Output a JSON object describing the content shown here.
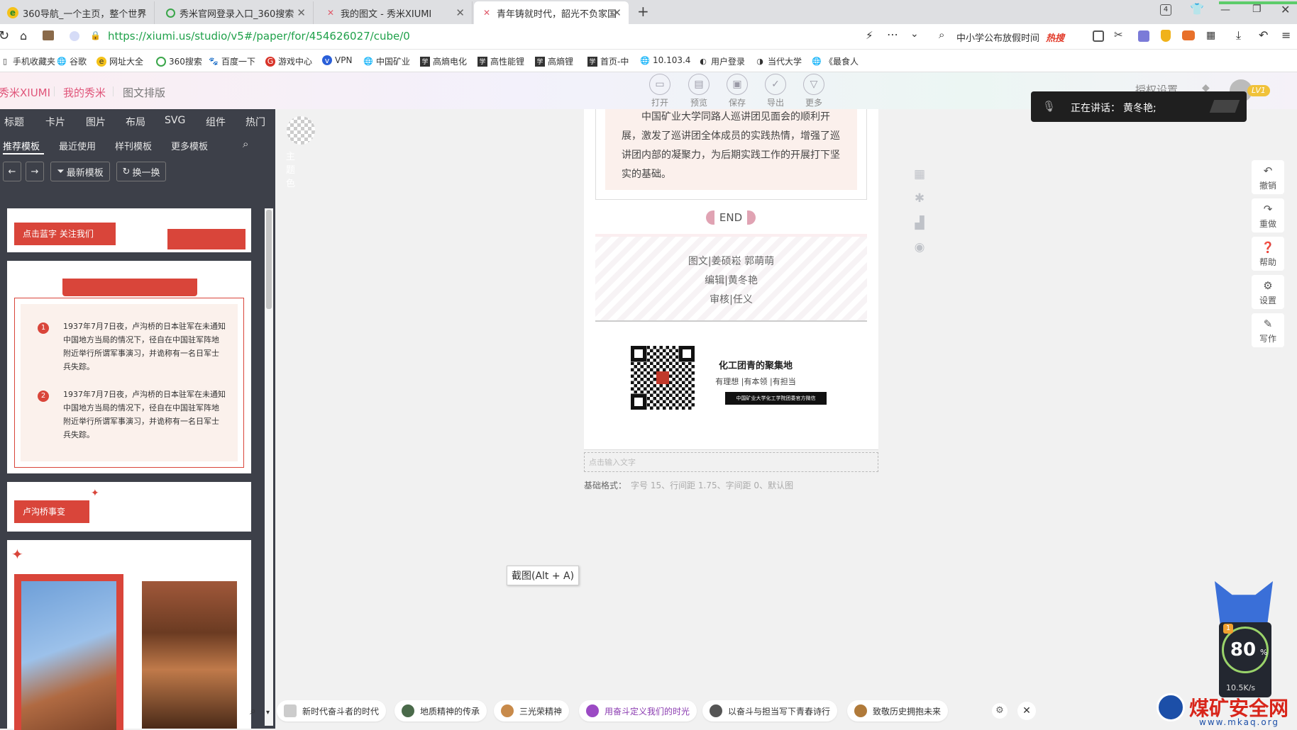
{
  "browser": {
    "tabs": [
      {
        "label": "360导航_一个主页，整个世界",
        "icon": "360-nav-icon",
        "active": false
      },
      {
        "label": "秀米官网登录入口_360搜索",
        "icon": "search-360-icon",
        "active": false
      },
      {
        "label": "我的图文 - 秀米XIUMI",
        "icon": "xiumi-icon",
        "active": false
      },
      {
        "label": "青年铸就时代，韶光不负家国",
        "icon": "xiumi-icon",
        "active": true
      }
    ],
    "tab_count": "4",
    "url": "https://xiumi.us/studio/v5#/paper/for/454626027/cube/0",
    "search_hint": "中小学公布放假时间",
    "hot_label": "热搜",
    "bookmarks": [
      "手机收藏夹",
      "谷歌",
      "网址大全",
      "360搜索",
      "百度一下",
      "游戏中心",
      "VPN",
      "中国矿业",
      "高熵电化",
      "高性能锂",
      "高熵锂",
      "首页-中",
      "10.103.4",
      "用户登录",
      "当代大学",
      "《最食人"
    ]
  },
  "app": {
    "brand": "秀米XIUMI",
    "nav": [
      "我的秀米",
      "图文排版"
    ],
    "toolbar": [
      "打开",
      "预览",
      "保存",
      "导出",
      "更多"
    ],
    "auth_label": "授权设置",
    "level_badge": "LV1"
  },
  "voice": {
    "label": "正在讲话：",
    "speaker": "黄冬艳;"
  },
  "left_panel": {
    "categories": [
      "标题",
      "卡片",
      "图片",
      "布局",
      "SVG",
      "组件",
      "热门"
    ],
    "theme_label": "主题色",
    "subtabs": [
      "推荐模板",
      "最近使用",
      "样刊模板",
      "更多模板"
    ],
    "buttons": {
      "latest": "最新模板",
      "shuffle": "换一换"
    },
    "templates": {
      "follow_label": "点击蓝字 关注我们",
      "item_text": "1937年7月7日夜，卢沟桥的日本驻军在未通知中国地方当局的情况下，径自在中国驻军阵地附近举行所谓军事演习，并诡称有一名日军士兵失踪。",
      "item_numbers": [
        "1",
        "2"
      ],
      "section_label": "卢沟桥事变"
    }
  },
  "article": {
    "paragraph": "中国矿业大学同路人巡讲团见面会的顺利开展，激发了巡讲团全体成员的实践热情，增强了巡讲团内部的凝聚力，为后期实践工作的开展打下坚实的基础。",
    "end_label": "END",
    "credits": [
      "图文|姜硕崧 郭萌萌",
      "编辑|黄冬艳",
      "审核|任义"
    ],
    "qr_title": "化工团青的聚集地",
    "qr_slogan": "有理想 |有本领 |有担当",
    "qr_org": "中国矿业大学化工学院团委官方微信",
    "input_placeholder": "点击输入文字",
    "format_label": "基础格式：",
    "format_value": "字号 15、行间距 1.75、字间距 0、默认图"
  },
  "right_tools": [
    "撤销",
    "重做",
    "帮助",
    "设置",
    "写作"
  ],
  "screenshot_tip": "截图(Alt + A)",
  "suggestions": [
    "新时代奋斗者的时代",
    "地质精神的传承",
    "三光荣精神",
    "用奋斗定义我们的时光",
    "以奋斗与担当写下青春诗行",
    "致敬历史拥抱未来"
  ],
  "widget": {
    "percent": "80",
    "unit": "%",
    "speed": "10.5K/s",
    "badge": "1"
  },
  "watermark": {
    "title": "煤矿安全网",
    "url": "www.mkaq.org"
  }
}
